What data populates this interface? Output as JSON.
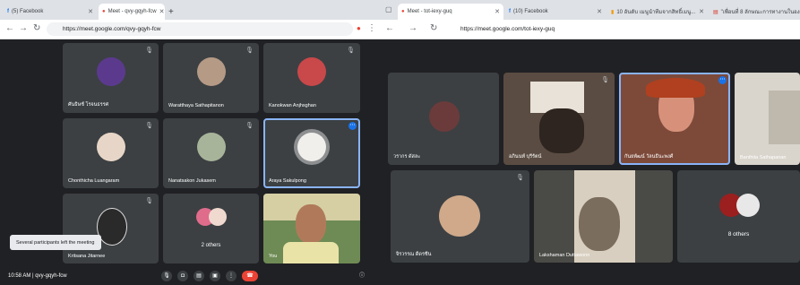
{
  "left": {
    "tabs": [
      {
        "label": "(5) Facebook",
        "icon": "facebook-icon"
      },
      {
        "label": "Meet - qvy-gqyh-fcw",
        "icon": "meet-icon"
      }
    ],
    "new_tab": "+",
    "url": "https://meet.google.com/qvy-gqyh-fcw",
    "tiles": [
      {
        "name": "ศันธิษช์ โรจนธรรศ",
        "avatar_color": "#5b3a8e"
      },
      {
        "name": "Waratthaya Sathapitanon",
        "avatar_color": "#b59a86"
      },
      {
        "name": "Kanokwan Anjhsghan",
        "avatar_color": "#c9484a"
      },
      {
        "name": "Chonthicha Luangaram",
        "avatar_color": "#e7d6c7"
      },
      {
        "name": "Nanatsakon Jukasem",
        "avatar_color": "#a8b49a"
      },
      {
        "name": "Araya Sakulpong",
        "avatar_color": "#f1efec"
      },
      {
        "name": "Kritsana Jitarnee",
        "avatar_color": "#2a2a2a"
      },
      {
        "name": "2 others",
        "avatar_color": "#e06c8c"
      },
      {
        "name": "You",
        "avatar_color": "#6e8b55"
      }
    ],
    "toast": "Several participants left the meeting",
    "time_code": "10:58 AM | qvy-gqyh-fcw"
  },
  "right": {
    "tabs": [
      {
        "label": "Meet - tot-iexy-guq",
        "icon": "meet-icon"
      },
      {
        "label": "(10) Facebook",
        "icon": "facebook-icon"
      },
      {
        "label": "10 อันดับ เมนูนำทีมจากสิทธิ์เมนู...",
        "icon": "orange-icon"
      },
      {
        "label": "\"เพื่อนที่ 8 ลักษณะการทางานในองค์...",
        "icon": "doc-icon"
      }
    ],
    "url": "https://meet.google.com/tot-iexy-guq",
    "tiles": [
      {
        "name": "วรากร ดัสละ",
        "avatar_color": "#6b3b3b"
      },
      {
        "name": "อภินนท์ บุรีรัตน์",
        "avatar_color": "#7a6250"
      },
      {
        "name": "กันยพัฒน์ วัลนธีนะพงศ์",
        "avatar_color": "#b04a33"
      },
      {
        "name": "Banthita Sathapanan",
        "avatar_color": "#c7c3bd"
      },
      {
        "name": "จิรวรรณ ดีดรชีน",
        "avatar_color": "#cfa98a"
      },
      {
        "name": "Lakshaman Duttawonn",
        "avatar_color": "#7b6d5e"
      },
      {
        "name": "8 others",
        "avatar_color": "#9b1f1f"
      }
    ]
  },
  "colors": {
    "stage": "#202124",
    "tile": "#3c4043",
    "accent": "#1a73e8",
    "end_call": "#ea4335"
  }
}
